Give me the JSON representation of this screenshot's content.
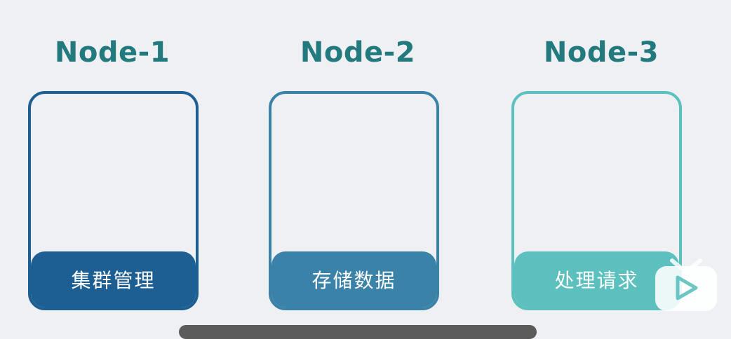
{
  "nodes": [
    {
      "title": "Node-1",
      "label": "集群管理",
      "color": "#1e5f93"
    },
    {
      "title": "Node-2",
      "label": "存储数据",
      "color": "#3a82a8"
    },
    {
      "title": "Node-3",
      "label": "处理请求",
      "color": "#5bc0be"
    }
  ],
  "icons": {
    "watermark": "tv-play-icon"
  },
  "colors": {
    "title_text": "#237a7e",
    "background": "#eef0f3",
    "bottom_bar": "#5b5b5b"
  }
}
